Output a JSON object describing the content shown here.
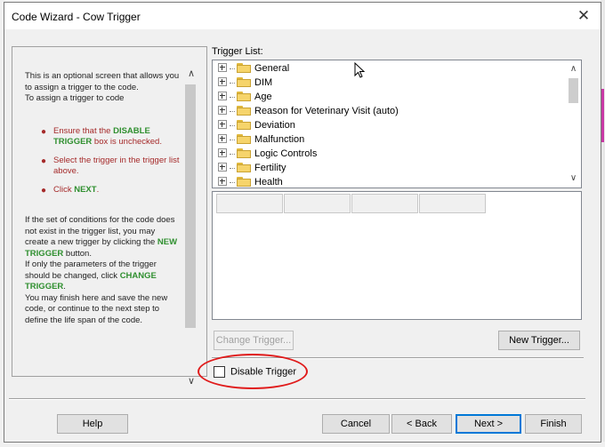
{
  "window": {
    "title": "Code Wizard - Cow Trigger",
    "close_glyph": "✕"
  },
  "help": {
    "intro": "This is an optional screen that allows you to assign a trigger to the code.",
    "intro2": "To assign a trigger to code",
    "bullets": [
      {
        "pre": "Ensure that the ",
        "hl": "DISABLE TRIGGER",
        "post": " box is unchecked."
      },
      {
        "pre": "Select the trigger in the trigger list above.",
        "hl": "",
        "post": ""
      },
      {
        "pre": "Click ",
        "hl": "NEXT",
        "post": "."
      }
    ],
    "para1_pre": "If the set of conditions for the code does not exist in the trigger list, you may create a new trigger by clicking the ",
    "para1_hl": "NEW TRIGGER",
    "para1_post": " button.",
    "para2_pre": "If only the parameters of the trigger should be changed, click ",
    "para2_hl": "CHANGE TRIGGER",
    "para2_post": ".",
    "para3": "You may finish here and save the new code, or continue to the next step to define the life span of the code."
  },
  "trigger_list": {
    "label": "Trigger List:",
    "items": [
      "General",
      "DIM",
      "Age",
      "Reason for Veterinary Visit (auto)",
      "Deviation",
      "Malfunction",
      "Logic Controls",
      "Fertility",
      "Health"
    ]
  },
  "grid": {
    "columns": [
      "",
      "",
      "",
      ""
    ]
  },
  "buttons": {
    "change_trigger": "Change Trigger...",
    "new_trigger": "New Trigger...",
    "help": "Help",
    "cancel": "Cancel",
    "back": "< Back",
    "next": "Next >",
    "finish": "Finish"
  },
  "disable_trigger": {
    "label": "Disable Trigger",
    "checked": false
  },
  "colors": {
    "highlight_green": "#2f8f2f",
    "bullet_red": "#a52a2a",
    "annotation_circle": "#e01b1b"
  },
  "icons": {
    "folder": "folder-icon",
    "expand": "plus-box-icon",
    "scroll_up": "chevron-up-icon",
    "scroll_down": "chevron-down-icon"
  }
}
